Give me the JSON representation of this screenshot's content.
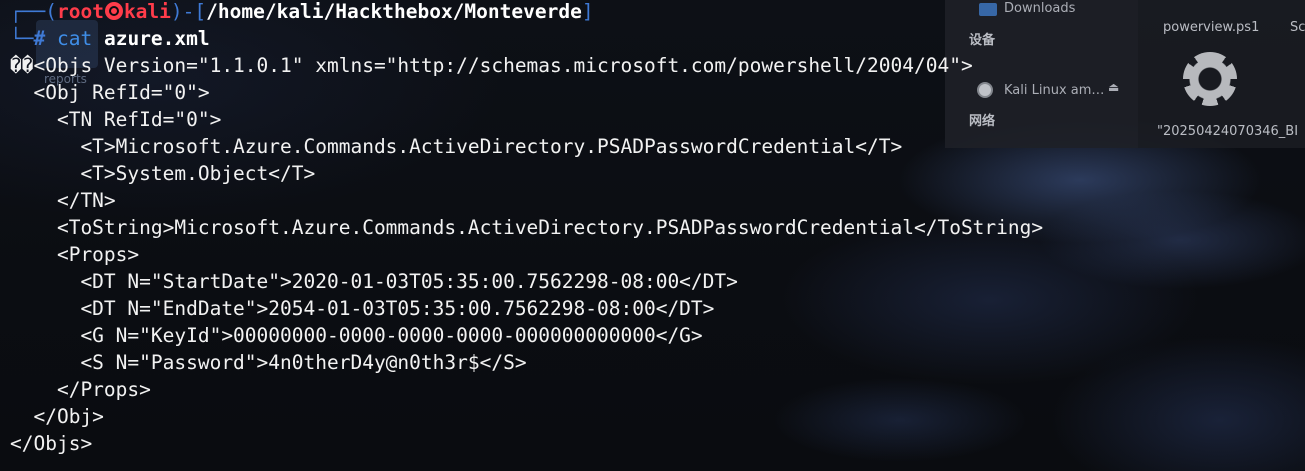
{
  "background": {
    "file_manager": {
      "sidebar": {
        "downloads": "Downloads",
        "devices_heading": "设备",
        "disk_label": "Kali Linux am…",
        "network_heading": "网络"
      },
      "files": {
        "powerview": "powerview.ps1",
        "partial_name": "Sc",
        "archive_name": "\"20250424070346_BI"
      },
      "reports_label": "reports"
    }
  },
  "terminal": {
    "prompt": {
      "frame_left": "┌──(",
      "user": "root",
      "host": "kali",
      "frame_mid": ")-[",
      "path": "/home/kali/Hackthebox/Monteverde",
      "frame_right": "]",
      "frame_bottom": "└─",
      "hash": "#",
      "command": "cat",
      "argument": "azure.xml"
    },
    "output_lines": [
      "��<Objs Version=\"1.1.0.1\" xmlns=\"http://schemas.microsoft.com/powershell/2004/04\">",
      "  <Obj RefId=\"0\">",
      "    <TN RefId=\"0\">",
      "      <T>Microsoft.Azure.Commands.ActiveDirectory.PSADPasswordCredential</T>",
      "      <T>System.Object</T>",
      "    </TN>",
      "    <ToString>Microsoft.Azure.Commands.ActiveDirectory.PSADPasswordCredential</ToString>",
      "    <Props>",
      "      <DT N=\"StartDate\">2020-01-03T05:35:00.7562298-08:00</DT>",
      "      <DT N=\"EndDate\">2054-01-03T05:35:00.7562298-08:00</DT>",
      "      <G N=\"KeyId\">00000000-0000-0000-0000-000000000000</G>",
      "      <S N=\"Password\">4n0therD4y@n0th3r$</S>",
      "    </Props>",
      "  </Obj>",
      "</Objs>"
    ]
  },
  "colors": {
    "prompt_frame": "#3f7ad6",
    "prompt_user": "#ff3c4a",
    "command": "#3f8ee8",
    "text": "#f2f2f2"
  }
}
